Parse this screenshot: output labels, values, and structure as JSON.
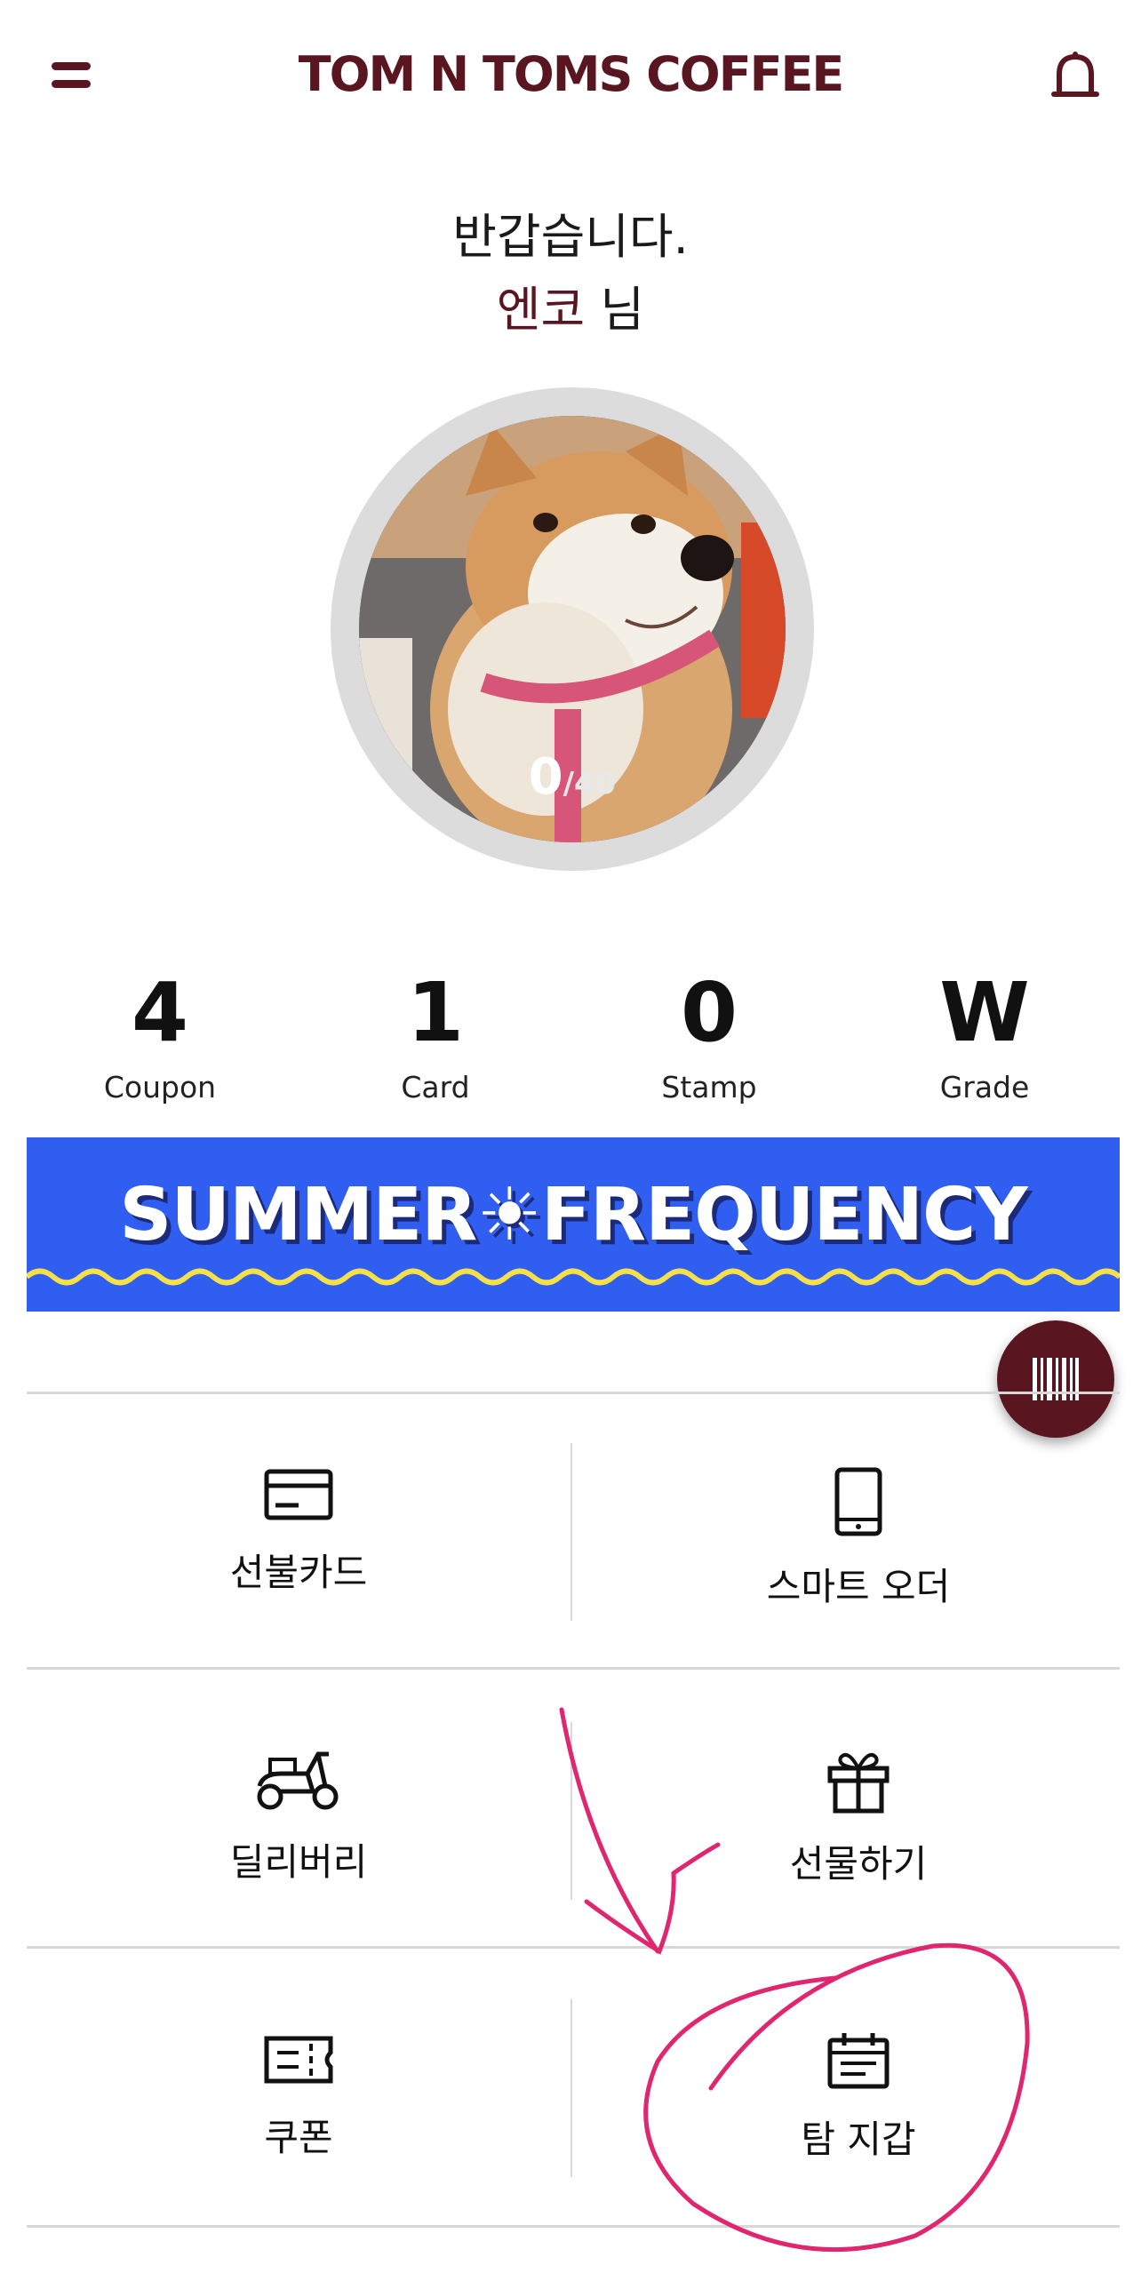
{
  "header": {
    "brand": "TOM N TOMS COFFEE",
    "menu_icon": "menu-icon",
    "bell_icon": "bell-icon"
  },
  "greeting": {
    "line1": "반갑습니다.",
    "name": "엔코",
    "suffix": " 님"
  },
  "profile": {
    "progress_current": "0",
    "progress_total": "/40"
  },
  "stats": [
    {
      "value": "4",
      "label": "Coupon"
    },
    {
      "value": "1",
      "label": "Card"
    },
    {
      "value": "0",
      "label": "Stamp"
    },
    {
      "value": "W",
      "label": "Grade"
    }
  ],
  "banner": {
    "text": "SUMMER☀FREQUENCY"
  },
  "menu": {
    "prepaid_card": "선불카드",
    "smart_order": "스마트 오더",
    "delivery": "딜리버리",
    "gift": "선물하기",
    "coupon": "쿠폰",
    "wallet": "탐 지갑"
  },
  "colors": {
    "brand": "#5a1620",
    "banner": "#2f5ef0",
    "annotation": "#e0266e"
  }
}
